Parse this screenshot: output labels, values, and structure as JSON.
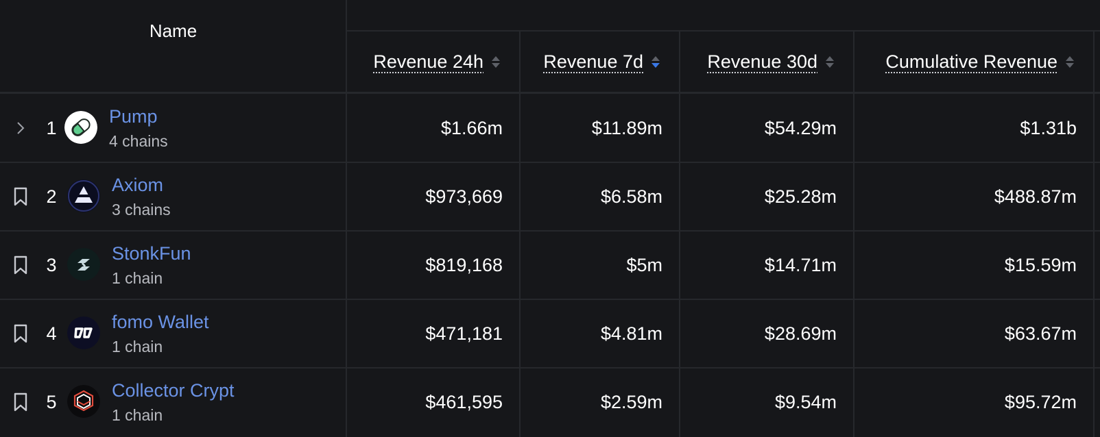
{
  "table": {
    "name_header": "Name",
    "columns": [
      {
        "label": "Revenue 24h",
        "sort": "none"
      },
      {
        "label": "Revenue 7d",
        "sort": "desc"
      },
      {
        "label": "Revenue 30d",
        "sort": "none"
      },
      {
        "label": "Cumulative Revenue",
        "sort": "none"
      }
    ],
    "rows": [
      {
        "rank": "1",
        "lead_icon": "chevron-right-icon",
        "name": "Pump",
        "chains": "4 chains",
        "logo": "pill-icon",
        "rev24h": "$1.66m",
        "rev7d": "$11.89m",
        "rev30d": "$54.29m",
        "cumulative": "$1.31b"
      },
      {
        "rank": "2",
        "lead_icon": "bookmark-icon",
        "name": "Axiom",
        "chains": "3 chains",
        "logo": "axiom-triangle-icon",
        "rev24h": "$973,669",
        "rev7d": "$6.58m",
        "rev30d": "$25.28m",
        "cumulative": "$488.87m"
      },
      {
        "rank": "3",
        "lead_icon": "bookmark-icon",
        "name": "StonkFun",
        "chains": "1 chain",
        "logo": "stonkfun-icon",
        "rev24h": "$819,168",
        "rev7d": "$5m",
        "rev30d": "$14.71m",
        "cumulative": "$15.59m"
      },
      {
        "rank": "4",
        "lead_icon": "bookmark-icon",
        "name": "fomo Wallet",
        "chains": "1 chain",
        "logo": "fomo-icon",
        "rev24h": "$471,181",
        "rev7d": "$4.81m",
        "rev30d": "$28.69m",
        "cumulative": "$63.67m"
      },
      {
        "rank": "5",
        "lead_icon": "bookmark-icon",
        "name": "Collector Crypt",
        "chains": "1 chain",
        "logo": "collector-crypt-icon",
        "rev24h": "$461,595",
        "rev7d": "$2.59m",
        "rev30d": "$9.54m",
        "cumulative": "$95.72m"
      }
    ]
  },
  "colors": {
    "background": "#16171a",
    "grid_line": "#26282c",
    "link": "#6b93e6",
    "sort_active": "#3a78e6"
  }
}
